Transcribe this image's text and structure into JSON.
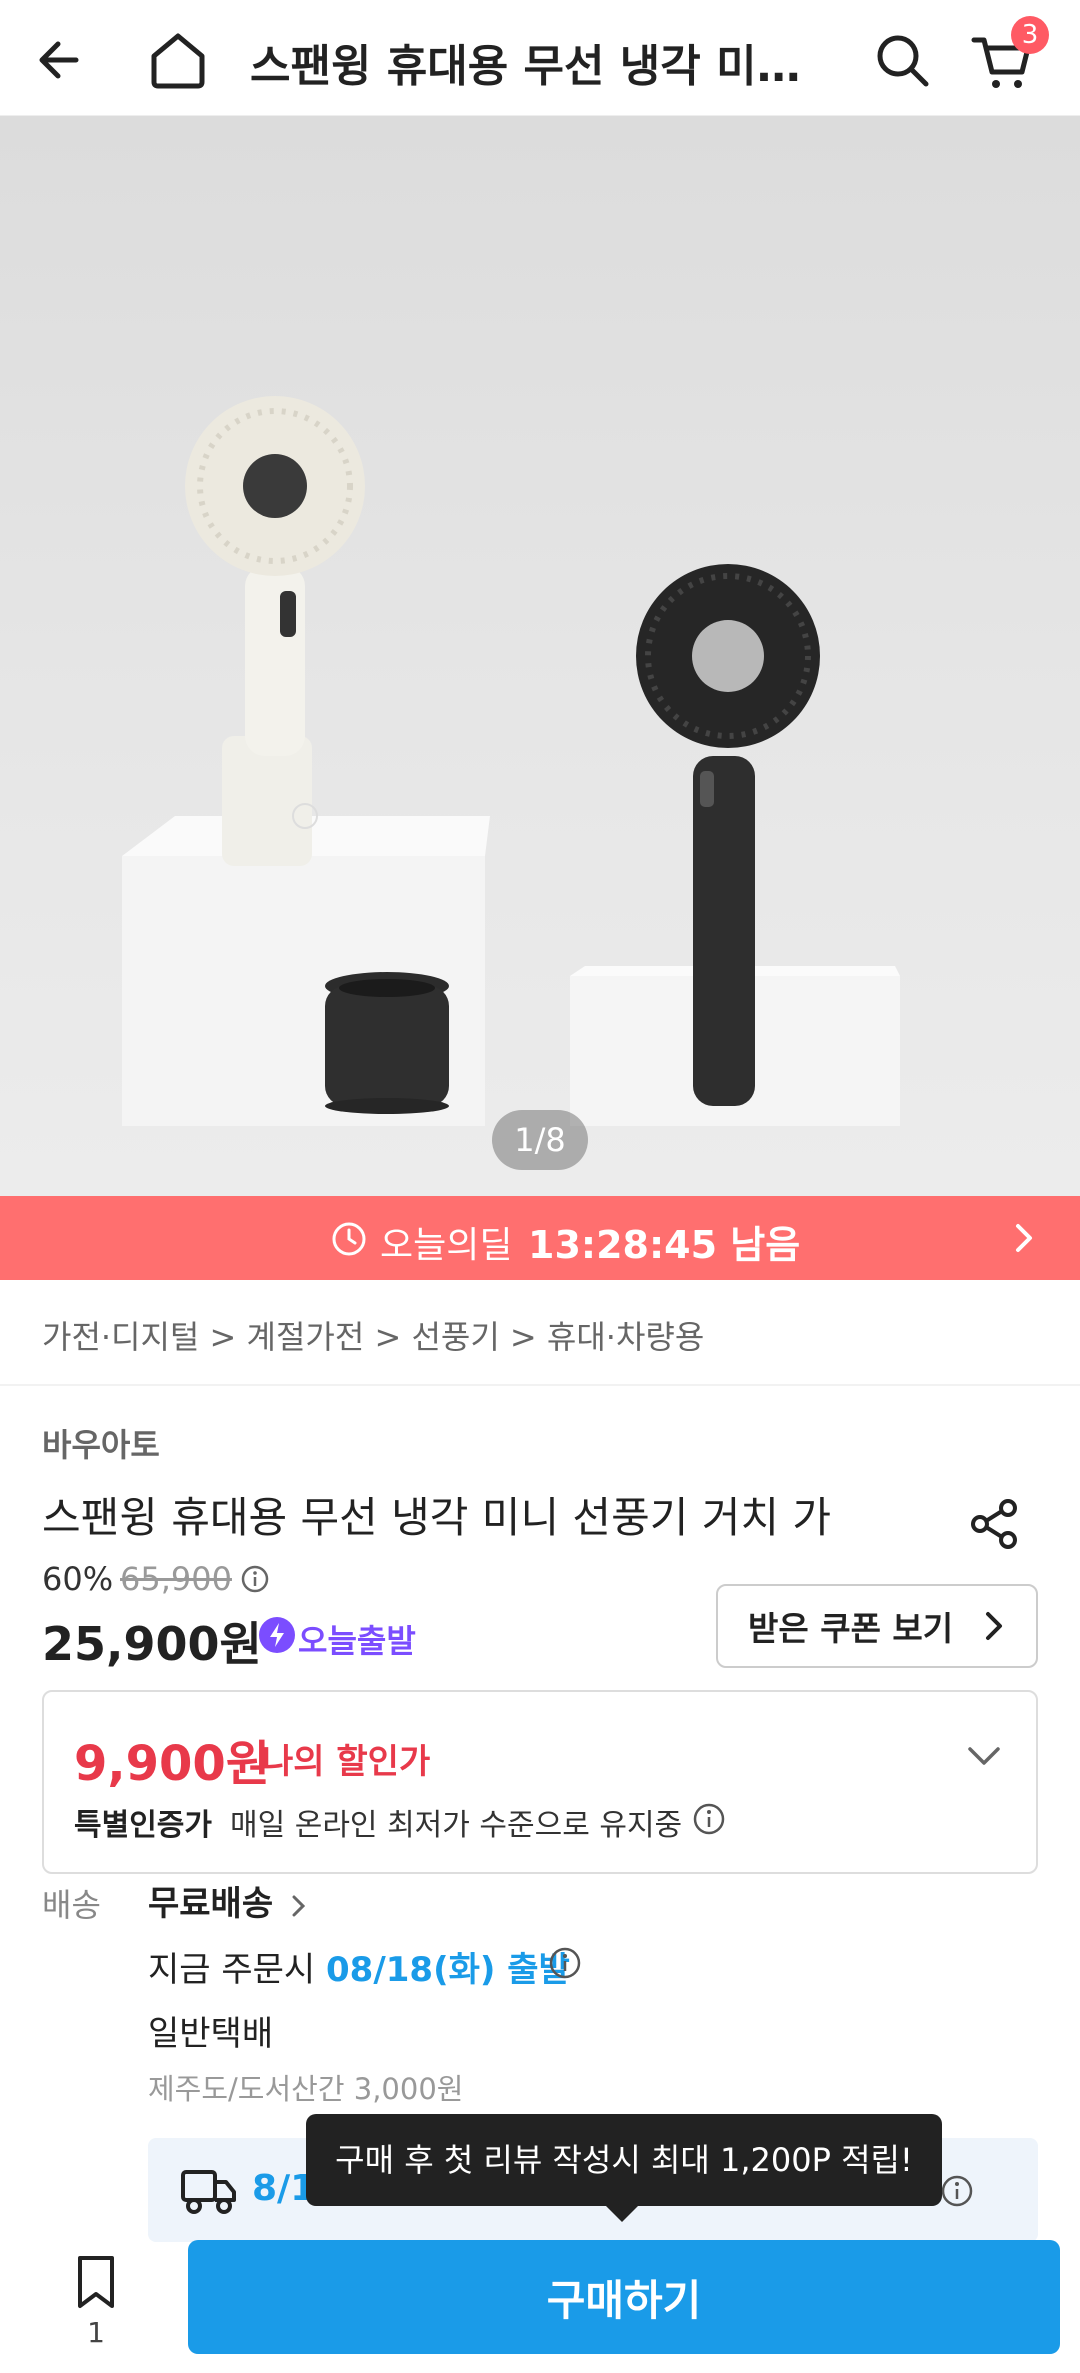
{
  "header": {
    "title": "스팬윙 휴대용 무선 냉각 미니 …",
    "cart_count": "3"
  },
  "hero": {
    "pager": "1/8"
  },
  "deal": {
    "label": "오늘의딜",
    "time": "13:28:45 남음"
  },
  "breadcrumb": "가전·디지털 > 계절가전 > 선풍기 > 휴대·차량용",
  "product": {
    "brand": "바우아토",
    "name": "스팬윙 휴대용 무선 냉각 미니 선풍기 거치 가",
    "discount": "60%",
    "original_price": "65,900",
    "price": "25,900원",
    "today_ship": "오늘출발",
    "coupon_button": "받은 쿠폰 보기"
  },
  "my_price": {
    "price": "9,900원",
    "label": "나의 할인가",
    "cert_title": "특별인증가",
    "cert_desc": "매일 온라인 최저가 수준으로 유지중"
  },
  "shipping": {
    "label": "배송",
    "free": "무료배송",
    "order_prefix": "지금 주문시 ",
    "order_date": "08/18(화) 출발",
    "method": "일반택배",
    "extra": "제주도/도서산간 3,000원",
    "arrival_date": "8/1"
  },
  "tooltip": "구매 후 첫 리뷰 작성시 최대 1,200P 적립!",
  "bottom": {
    "wish_count": "1",
    "buy_label": "구매하기"
  },
  "colors": {
    "accent": "#1a9be8",
    "deal": "#ff6f6f",
    "sale": "#e8394a",
    "today": "#7b4dff"
  }
}
